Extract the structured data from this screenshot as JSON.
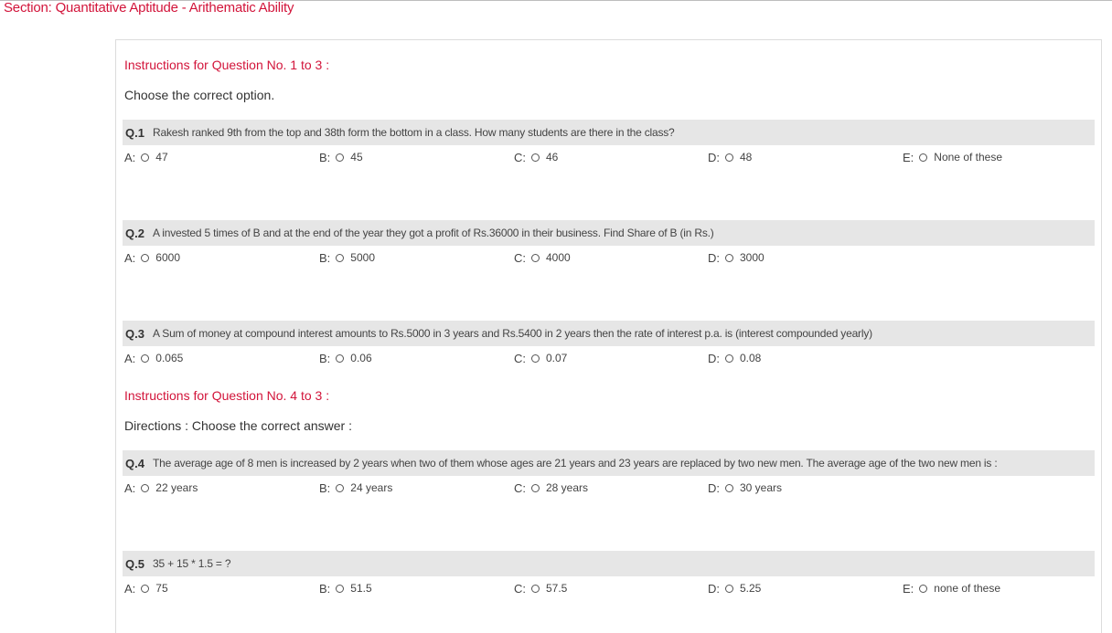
{
  "section": {
    "title": "Section: Quantitative Aptitude - Arithematic Ability"
  },
  "blocks": {
    "b1": {
      "title": "Instructions for Question No. 1 to 3 :",
      "text": "Choose the correct option."
    },
    "b2": {
      "title": "Instructions for Question No. 4 to 3 :",
      "text": "Directions : Choose the correct answer :"
    }
  },
  "questions": {
    "q1": {
      "num": "Q.1",
      "text": "Rakesh ranked 9th from the top and 38th form the bottom in a class. How many students are there in the class?",
      "options": {
        "a": {
          "letter": "A:",
          "value": "47"
        },
        "b": {
          "letter": "B:",
          "value": "45"
        },
        "c": {
          "letter": "C:",
          "value": "46"
        },
        "d": {
          "letter": "D:",
          "value": "48"
        },
        "e": {
          "letter": "E:",
          "value": "None of these"
        }
      }
    },
    "q2": {
      "num": "Q.2",
      "text": "A invested 5 times of B and at the end of the year they got a profit of Rs.36000 in their business. Find Share of B (in Rs.)",
      "options": {
        "a": {
          "letter": "A:",
          "value": "6000"
        },
        "b": {
          "letter": "B:",
          "value": "5000"
        },
        "c": {
          "letter": "C:",
          "value": "4000"
        },
        "d": {
          "letter": "D:",
          "value": "3000"
        }
      }
    },
    "q3": {
      "num": "Q.3",
      "text": "A Sum of money at compound interest amounts to Rs.5000 in 3 years and Rs.5400 in 2 years then the rate of interest p.a. is (interest compounded yearly)",
      "options": {
        "a": {
          "letter": "A:",
          "value": "0.065"
        },
        "b": {
          "letter": "B:",
          "value": "0.06"
        },
        "c": {
          "letter": "C:",
          "value": "0.07"
        },
        "d": {
          "letter": "D:",
          "value": "0.08"
        }
      }
    },
    "q4": {
      "num": "Q.4",
      "text": "The average age of 8 men is increased by 2 years when two of them whose ages are 21 years and 23 years are replaced by two new men. The average age of the two new men is :",
      "options": {
        "a": {
          "letter": "A:",
          "value": "22 years"
        },
        "b": {
          "letter": "B:",
          "value": "24 years"
        },
        "c": {
          "letter": "C:",
          "value": "28 years"
        },
        "d": {
          "letter": "D:",
          "value": "30 years"
        }
      }
    },
    "q5": {
      "num": "Q.5",
      "text": "35 + 15 * 1.5 = ?",
      "options": {
        "a": {
          "letter": "A:",
          "value": "75"
        },
        "b": {
          "letter": "B:",
          "value": "51.5"
        },
        "c": {
          "letter": "C:",
          "value": "57.5"
        },
        "d": {
          "letter": "D:",
          "value": "5.25"
        },
        "e": {
          "letter": "E:",
          "value": "none of these"
        }
      }
    }
  }
}
